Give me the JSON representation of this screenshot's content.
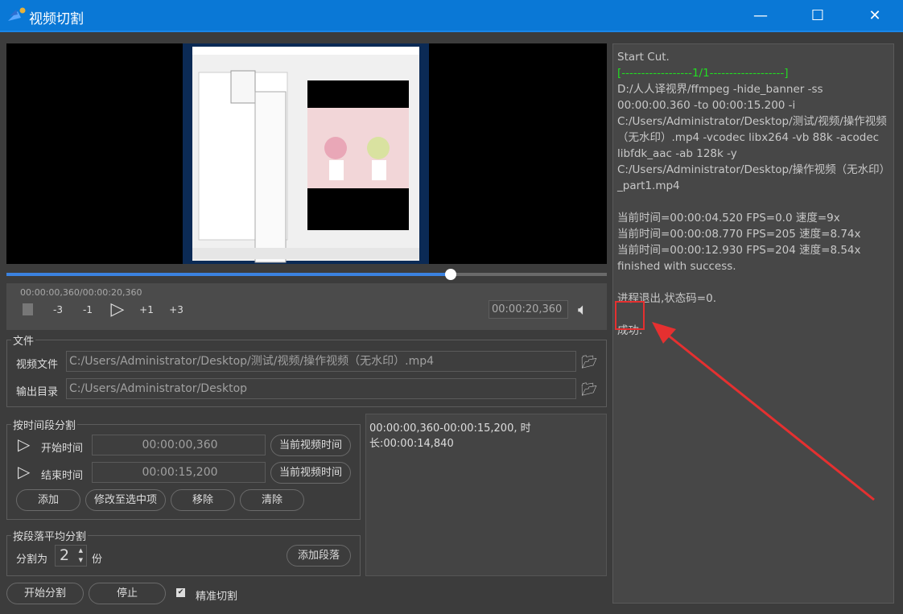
{
  "window": {
    "title": "视频切割",
    "min": "—",
    "max": "☐",
    "close": "✕"
  },
  "player": {
    "position_text": "00:00:00,360/00:00:20,360",
    "duration": "00:00:20,360",
    "progress_percent": 74,
    "buttons": [
      "stop",
      "back-3",
      "back-1",
      "play",
      "fwd-1",
      "fwd-3"
    ],
    "back3": "-3",
    "back1": "-1",
    "fwd1": "+1",
    "fwd3": "+3"
  },
  "files": {
    "group": "文件",
    "video_label": "视频文件",
    "video_path": "C:/Users/Administrator/Desktop/测试/视频/操作视频（无水印）.mp4",
    "output_label": "输出目录",
    "output_path": "C:/Users/Administrator/Desktop"
  },
  "by_time": {
    "group": "按时间段分割",
    "start_label": "开始时间",
    "start_value": "00:00:00,360",
    "end_label": "结束时间",
    "end_value": "00:00:15,200",
    "current_btn": "当前视频时间",
    "add": "添加",
    "modify": "修改至选中项",
    "remove": "移除",
    "clear": "清除"
  },
  "by_segment": {
    "group": "按段落平均分割",
    "split_label": "分割为",
    "count": "2",
    "unit": "份",
    "add": "添加段落"
  },
  "segments": [
    "00:00:00,360-00:00:15,200, 时长:00:00:14,840"
  ],
  "actions": {
    "start": "开始分割",
    "stop": "停止",
    "precise": "精准切割",
    "precise_checked": true
  },
  "log": [
    "Start Cut.",
    "[------------------1/1-------------------]",
    "D:/人人译视界/ffmpeg -hide_banner -ss 00:00:00.360 -to 00:00:15.200 -i C:/Users/Administrator/Desktop/测试/视频/操作视频（无水印）.mp4 -vcodec libx264 -vb 88k -acodec libfdk_aac -ab 128k -y C:/Users/Administrator/Desktop/操作视频（无水印）_part1.mp4",
    "",
    "当前时间=00:00:04.520 FPS=0.0 速度=9x",
    "当前时间=00:00:08.770 FPS=205 速度=8.74x",
    "当前时间=00:00:12.930 FPS=204 速度=8.54x",
    "finished with success.",
    "",
    "进程退出,状态码=0.",
    "",
    "成功."
  ],
  "colors": {
    "accent": "#0a78d6",
    "progress": "#3b82e0",
    "log_green": "#22dd22",
    "annotation": "#e53030"
  }
}
